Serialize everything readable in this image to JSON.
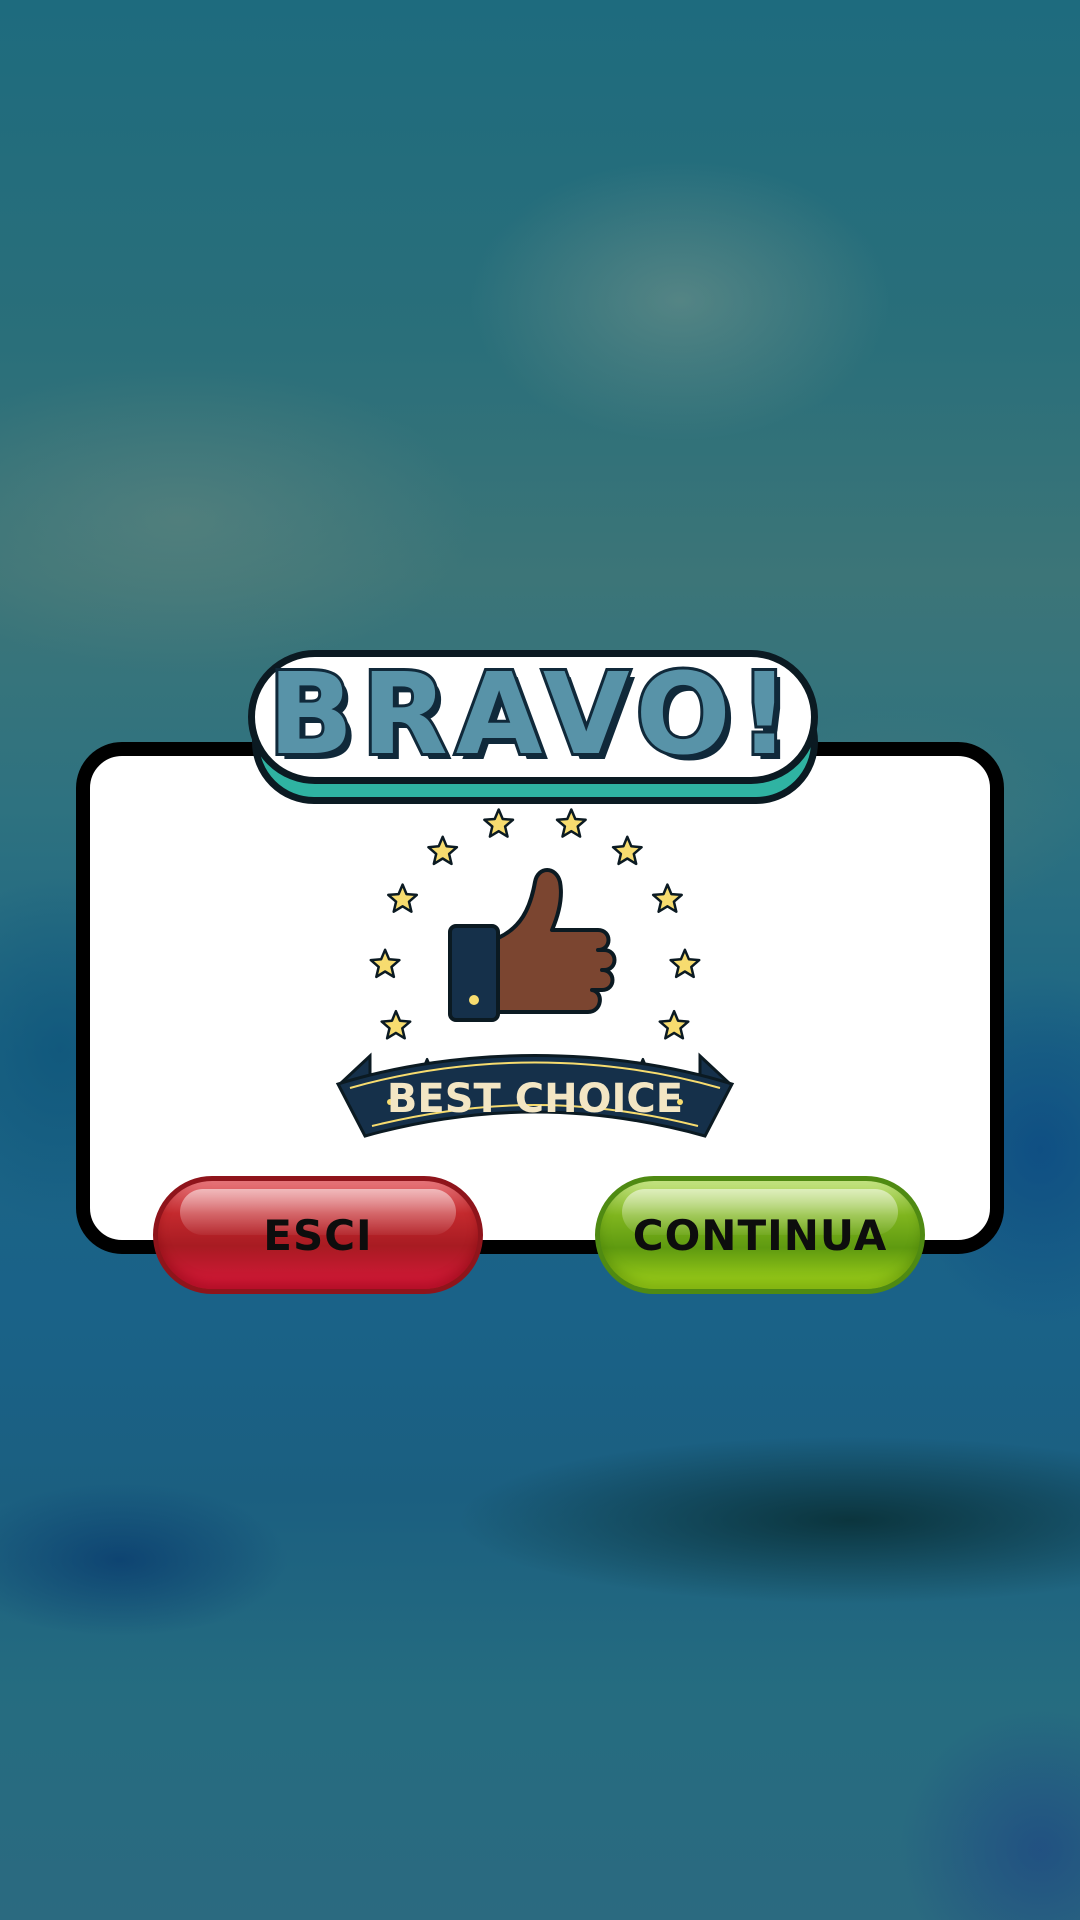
{
  "dialog": {
    "title": "BRAVO!",
    "badge": {
      "banner_text": "BEST CHOICE",
      "icon": "thumbs-up-icon",
      "star_icon": "star-icon"
    }
  },
  "buttons": {
    "exit_label": "ESCI",
    "continue_label": "CONTINUA"
  },
  "colors": {
    "title_fill": "#5893a8",
    "header_shadow": "#2fb3a2",
    "exit_button": "#c42a2e",
    "continue_button": "#7fb51e",
    "banner": "#15304a",
    "stars": "#f7dc6f"
  }
}
